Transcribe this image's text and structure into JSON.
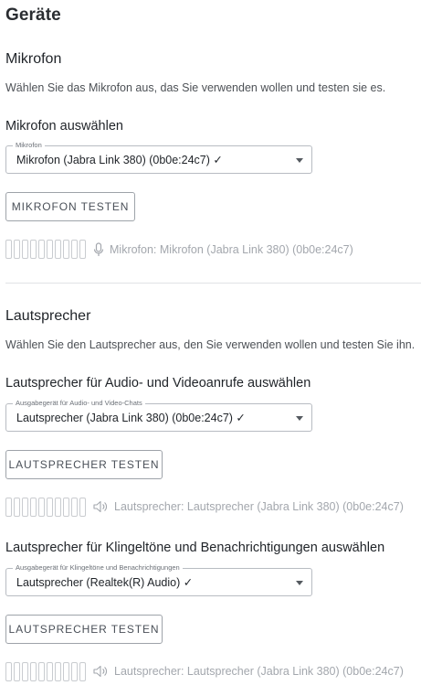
{
  "page": {
    "title": "Geräte"
  },
  "microphone": {
    "heading": "Mikrofon",
    "description": "Wählen Sie das Mikrofon aus, das Sie verwenden wollen und testen sie es.",
    "select_heading": "Mikrofon auswählen",
    "select_legend": "Mikrofon",
    "select_value": "Mikrofon (Jabra Link 380) (0b0e:24c7) ✓",
    "test_button": "MIKROFON TESTEN",
    "status_text": "Mikrofon: Mikrofon (Jabra Link 380) (0b0e:24c7)",
    "status_icon": "microphone-icon",
    "meter_segments": 10
  },
  "speaker": {
    "heading": "Lautsprecher",
    "description": "Wählen Sie den Lautsprecher aus, den Sie verwenden wollen und testen Sie ihn.",
    "calls": {
      "select_heading": "Lautsprecher für Audio- und Videoanrufe auswählen",
      "select_legend": "Ausgabegerät für Audio- und Video-Chats",
      "select_value": "Lautsprecher (Jabra Link 380) (0b0e:24c7) ✓",
      "test_button": "LAUTSPRECHER TESTEN",
      "status_text": "Lautsprecher: Lautsprecher (Jabra Link 380) (0b0e:24c7)",
      "status_icon": "speaker-icon"
    },
    "ringtones": {
      "select_heading": "Lautsprecher für Klingeltöne und Benachrichtigungen auswählen",
      "select_legend": "Ausgabegerät für Klingeltöne und Benachrichtigungen",
      "select_value": "Lautsprecher (Realtek(R) Audio) ✓",
      "test_button": "LAUTSPRECHER TESTEN",
      "status_text": "Lautsprecher: Lautsprecher (Jabra Link 380) (0b0e:24c7)",
      "status_icon": "speaker-icon"
    }
  }
}
